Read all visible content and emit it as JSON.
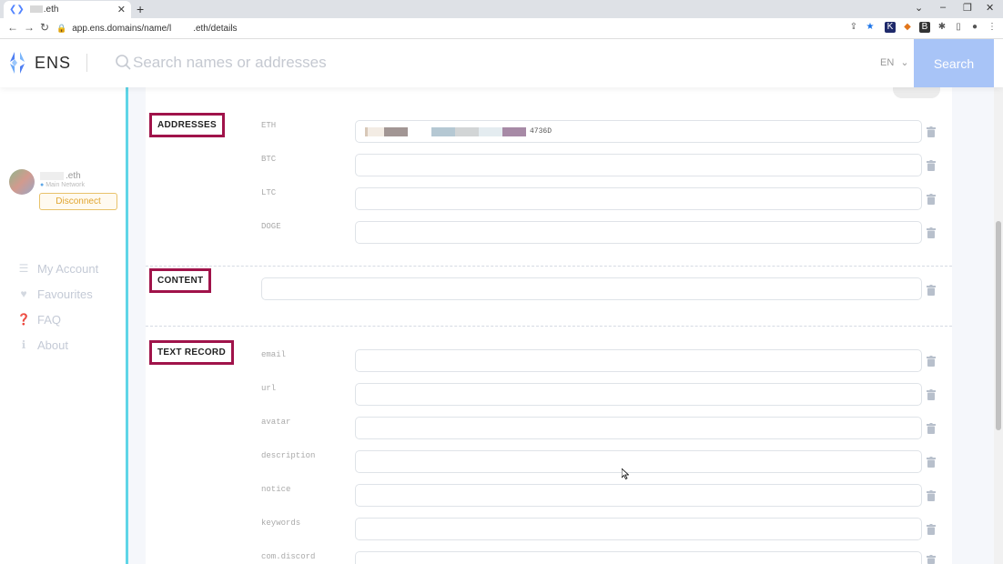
{
  "browser": {
    "tab_title": ".eth",
    "url_part1": "app.ens.domains/name/l",
    "url_part2": ".eth/details"
  },
  "header": {
    "logo_text": "ENS",
    "search_placeholder": "Search names or addresses",
    "lang": "EN",
    "search_button": "Search"
  },
  "account": {
    "name_suffix": ".eth",
    "network": "Main Network",
    "disconnect": "Disconnect"
  },
  "nav": [
    {
      "label": "My Account",
      "icon": "list-icon"
    },
    {
      "label": "Favourites",
      "icon": "heart-icon"
    },
    {
      "label": "FAQ",
      "icon": "question-icon"
    },
    {
      "label": "About",
      "icon": "info-icon"
    }
  ],
  "sections": {
    "addresses": "ADDRESSES",
    "content": "CONTENT",
    "text_record": "TEXT RECORD"
  },
  "addresses": [
    {
      "label": "ETH",
      "value_suffix": "4736D"
    },
    {
      "label": "BTC",
      "value": ""
    },
    {
      "label": "LTC",
      "value": ""
    },
    {
      "label": "DOGE",
      "value": ""
    }
  ],
  "text_records": [
    {
      "label": "email"
    },
    {
      "label": "url"
    },
    {
      "label": "avatar"
    },
    {
      "label": "description"
    },
    {
      "label": "notice"
    },
    {
      "label": "keywords"
    },
    {
      "label": "com.discord"
    }
  ],
  "colors": {
    "accent": "#a0134a",
    "rail": "#5fd5e7",
    "search_button": "#a8c4f7"
  }
}
